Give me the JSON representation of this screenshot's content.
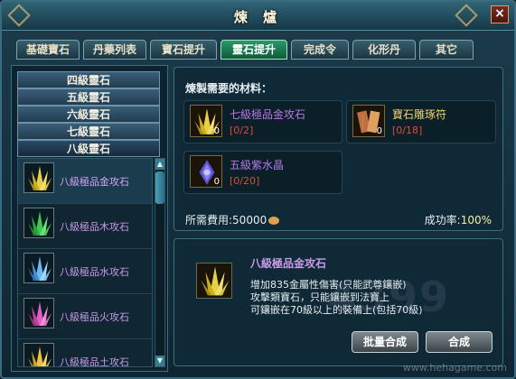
{
  "window": {
    "title": "煉 爐"
  },
  "tabs": [
    {
      "label": "基礎寶石"
    },
    {
      "label": "丹藥列表"
    },
    {
      "label": "寶石提升"
    },
    {
      "label": "靈石提升"
    },
    {
      "label": "完成令"
    },
    {
      "label": "化形丹"
    },
    {
      "label": "其它"
    }
  ],
  "grades": [
    {
      "label": "四級靈石"
    },
    {
      "label": "五級靈石"
    },
    {
      "label": "六級靈石"
    },
    {
      "label": "七級靈石"
    },
    {
      "label": "八級靈石"
    }
  ],
  "items": [
    {
      "label": "八級極品金攻石",
      "icon": "gold-crystal-icon"
    },
    {
      "label": "八級極品木攻石",
      "icon": "green-crystal-icon"
    },
    {
      "label": "八級極品水攻石",
      "icon": "blue-crystal-icon"
    },
    {
      "label": "八級極品火攻石",
      "icon": "pink-crystal-icon"
    },
    {
      "label": "八級極品土攻石",
      "icon": "yellow-crystal-icon"
    }
  ],
  "materials": {
    "header": "煉製需要的材料：",
    "list": [
      {
        "name": "七級極品金攻石",
        "count": "0",
        "qty": "[0/2]"
      },
      {
        "name": "寶石雕琢符",
        "count": "0",
        "qty": "[0/18]"
      },
      {
        "name": "五級紫水晶",
        "count": "0",
        "qty": "[0/20]"
      }
    ]
  },
  "cost": {
    "label": "所需費用:",
    "value": "50000"
  },
  "rate": {
    "label": "成功率:",
    "value": "100%"
  },
  "detail": {
    "name": "八級極品金攻石",
    "line1": "增加835金屬性傷害(只能武尊鑲嵌)",
    "line2": "攻擊類寶石，只能鑲嵌到法寶上",
    "line3": "可鑲嵌在70級以上的裝備上(包括70級)"
  },
  "buttons": {
    "batch": "批量合成",
    "combine": "合成"
  },
  "watermark": {
    "logo": "4399",
    "url": "www.hehagame.com"
  }
}
